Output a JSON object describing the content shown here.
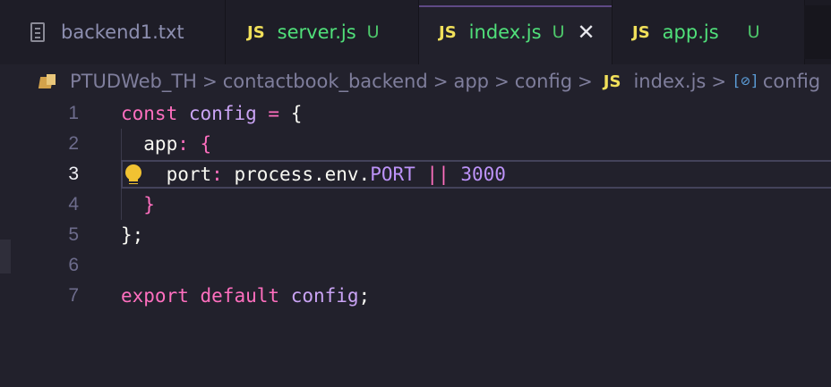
{
  "tabs": [
    {
      "label": "backend1.txt",
      "type": "text",
      "color": "#8d8fb0",
      "git": "",
      "active": false
    },
    {
      "label": "server.js",
      "type": "js",
      "color": "#50e07a",
      "git": "U",
      "active": false
    },
    {
      "label": "index.js",
      "type": "js",
      "color": "#50e07a",
      "git": "U",
      "active": true
    },
    {
      "label": "app.js",
      "type": "js",
      "color": "#50e07a",
      "git": "U",
      "active": false
    }
  ],
  "tab_js_badge": "JS",
  "tab_close_glyph": "✕",
  "breadcrumbs": {
    "items": [
      "PTUDWeb_TH",
      "contactbook_backend",
      "app",
      "config",
      "index.js",
      "config"
    ],
    "js_badge": "JS",
    "symbol_glyph": "[⊘]",
    "separator": ">"
  },
  "editor": {
    "current_line": 3,
    "lines": [
      {
        "no": "1",
        "tokens": [
          {
            "t": "const",
            "c": "k"
          },
          {
            "t": " ",
            "c": "p"
          },
          {
            "t": "config",
            "c": "v"
          },
          {
            "t": " ",
            "c": "p"
          },
          {
            "t": "=",
            "c": "o"
          },
          {
            "t": " {",
            "c": "p"
          }
        ]
      },
      {
        "no": "2",
        "tokens": [
          {
            "t": "  app",
            "c": "p"
          },
          {
            "t": ":",
            "c": "o"
          },
          {
            "t": " ",
            "c": "p"
          },
          {
            "t": "{",
            "c": "br"
          }
        ]
      },
      {
        "no": "3",
        "tokens": [
          {
            "t": "    port",
            "c": "p"
          },
          {
            "t": ":",
            "c": "o"
          },
          {
            "t": " process.env.",
            "c": "p"
          },
          {
            "t": "PORT",
            "c": "n"
          },
          {
            "t": " ",
            "c": "p"
          },
          {
            "t": "||",
            "c": "o"
          },
          {
            "t": " ",
            "c": "p"
          },
          {
            "t": "3000",
            "c": "n"
          }
        ]
      },
      {
        "no": "4",
        "tokens": [
          {
            "t": "  ",
            "c": "p"
          },
          {
            "t": "}",
            "c": "br"
          }
        ]
      },
      {
        "no": "5",
        "tokens": [
          {
            "t": "};",
            "c": "p"
          }
        ]
      },
      {
        "no": "6",
        "tokens": []
      },
      {
        "no": "7",
        "tokens": [
          {
            "t": "export",
            "c": "k"
          },
          {
            "t": " ",
            "c": "p"
          },
          {
            "t": "default",
            "c": "k"
          },
          {
            "t": " ",
            "c": "p"
          },
          {
            "t": "config",
            "c": "v"
          },
          {
            "t": ";",
            "c": "p"
          }
        ]
      }
    ]
  }
}
